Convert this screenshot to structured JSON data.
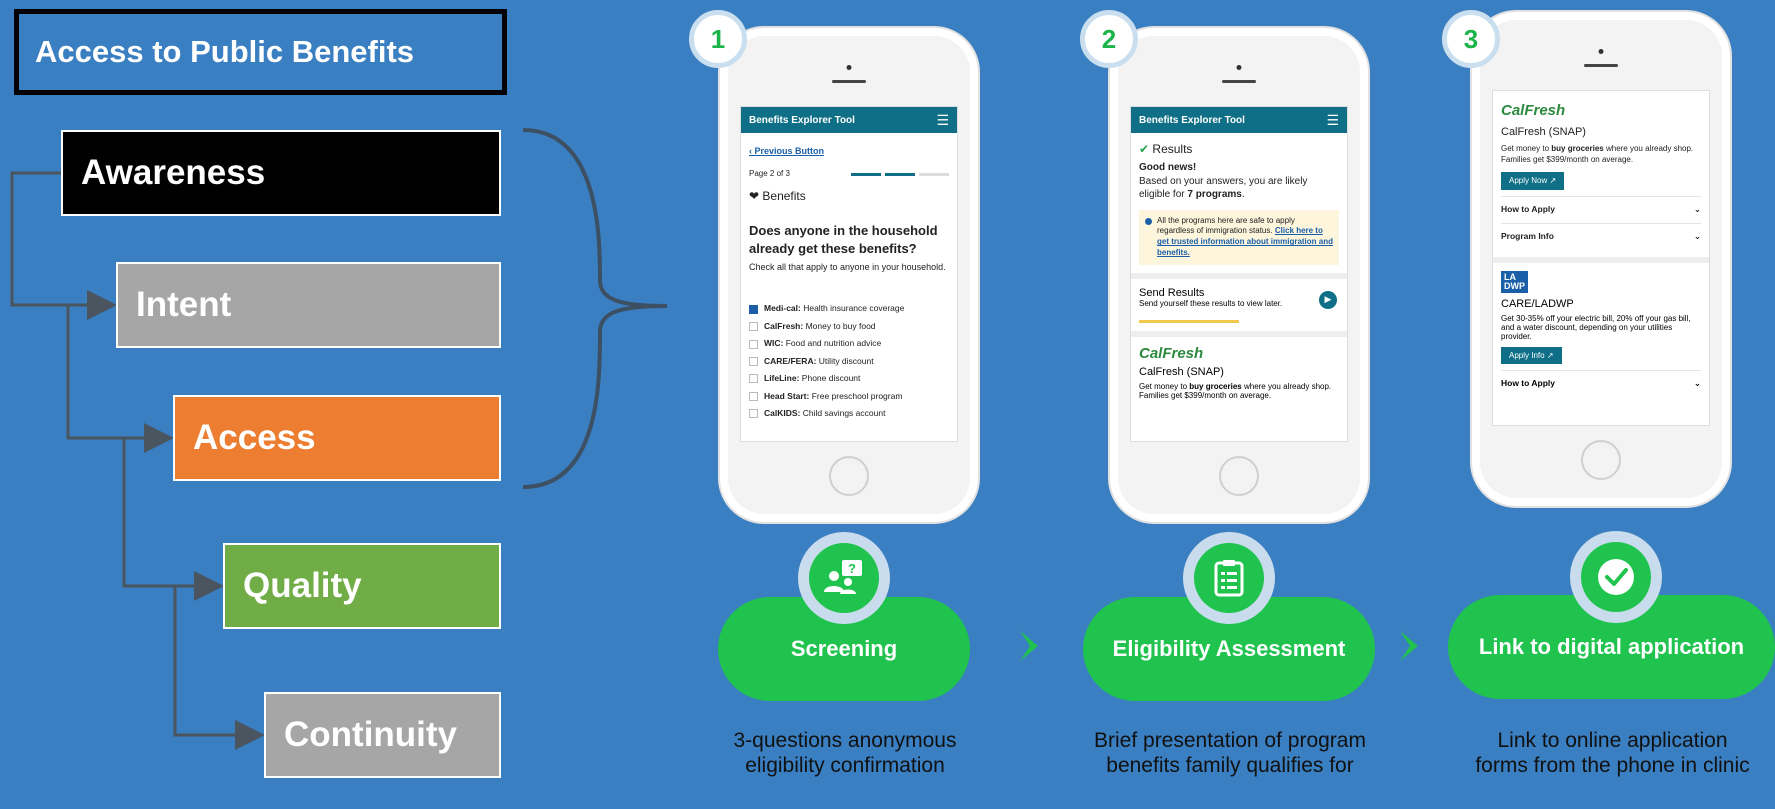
{
  "title": "Access to Public Benefits",
  "stages": [
    "Awareness",
    "Intent",
    "Access",
    "Quality",
    "Continuity"
  ],
  "steps": [
    {
      "number": "1",
      "label": "Screening",
      "description": "3-questions anonymous eligibility confirmation"
    },
    {
      "number": "2",
      "label": "Eligibility Assessment",
      "description": "Brief presentation of program benefits family qualifies for"
    },
    {
      "number": "3",
      "label": "Link to digital application",
      "description": "Link to online application forms from the phone in clinic"
    }
  ],
  "phone1": {
    "app_title": "Benefits Explorer Tool",
    "back_link": "Previous Button",
    "page_indicator": "Page 2 of 3",
    "section": "Benefits",
    "question": "Does anyone in the household already get these benefits?",
    "hint": "Check all that apply to anyone in your household.",
    "options": [
      {
        "name": "Medi-cal:",
        "desc": "Health insurance coverage",
        "checked": true
      },
      {
        "name": "CalFresh:",
        "desc": "Money to buy food",
        "checked": false
      },
      {
        "name": "WIC:",
        "desc": "Food and nutrition advice",
        "checked": false
      },
      {
        "name": "CARE/FERA:",
        "desc": "Utility discount",
        "checked": false
      },
      {
        "name": "LifeLine:",
        "desc": "Phone discount",
        "checked": false
      },
      {
        "name": "Head Start:",
        "desc": "Free preschool program",
        "checked": false
      },
      {
        "name": "CalKIDS:",
        "desc": "Child savings account",
        "checked": false
      }
    ]
  },
  "phone2": {
    "app_title": "Benefits Explorer Tool",
    "results_heading": "Results",
    "good_news": "Good news!",
    "summary_prefix": "Based on your answers, you are likely eligible for",
    "summary_bold": "7 programs",
    "summary_suffix": ".",
    "note_text": "All the programs here are safe to apply regardless of immigration status.",
    "note_link": "Click here to get trusted information about immigration and benefits.",
    "send_title": "Send Results",
    "send_desc": "Send yourself these results to view later.",
    "program_logo": "CalFresh",
    "program_name": "CalFresh (SNAP)",
    "program_desc_prefix": "Get money to",
    "program_desc_bold": "buy groceries",
    "program_desc_suffix": "where you already shop. Families get $399/month on average."
  },
  "phone3": {
    "logo1": "CalFresh",
    "program1_name": "CalFresh (SNAP)",
    "program1_desc_prefix": "Get money to",
    "program1_desc_bold": "buy groceries",
    "program1_desc_suffix": "where you already shop. Families get $399/month on average.",
    "apply_now": "Apply Now",
    "how_to_apply": "How to Apply",
    "program_info": "Program Info",
    "logo2_line1": "LA",
    "logo2_line2": "DWP",
    "program2_name": "CARE/LADWP",
    "program2_desc": "Get 30-35% off your electric bill, 20% off your gas bill, and a water discount, depending on your utilities provider.",
    "apply_info": "Apply Info",
    "how_to_apply2": "How to Apply"
  }
}
